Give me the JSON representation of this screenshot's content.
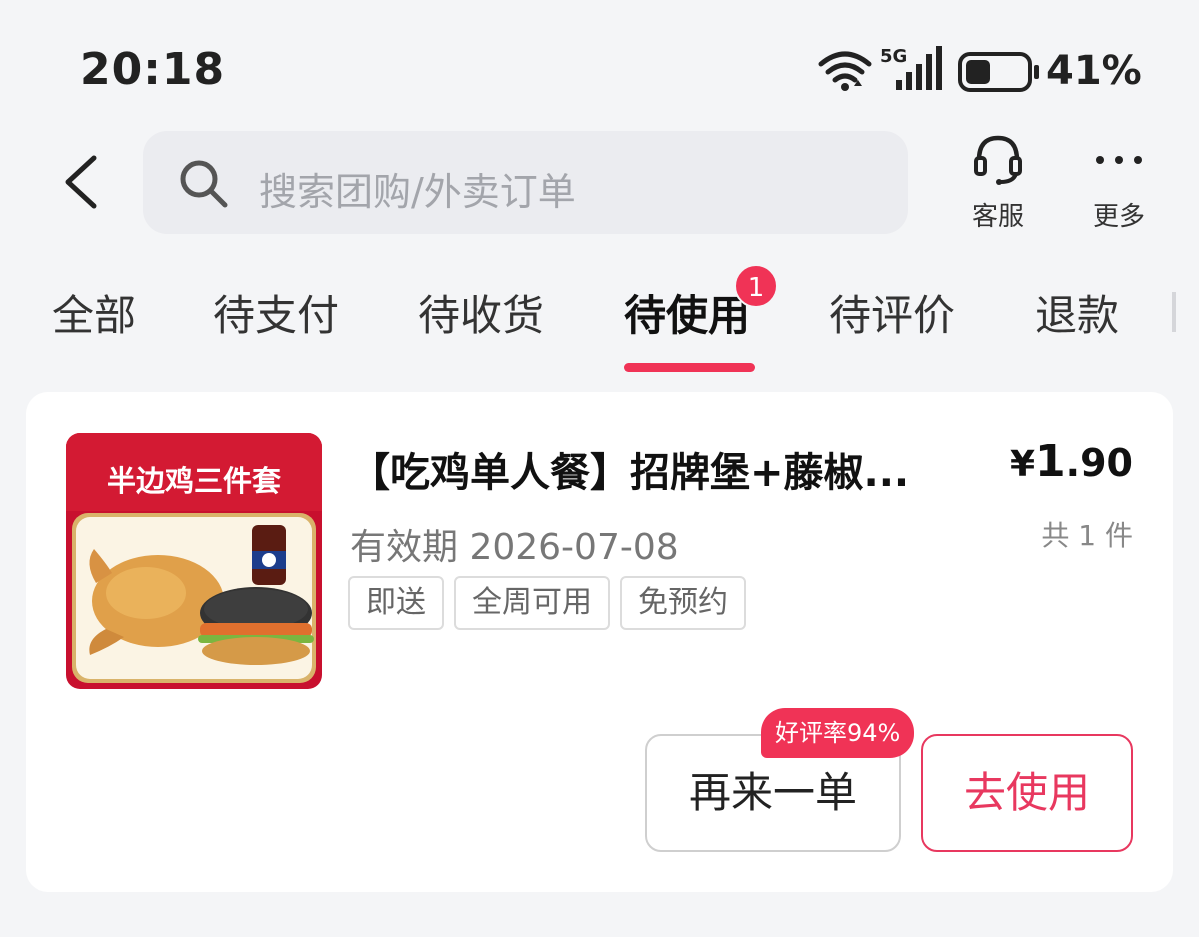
{
  "status_bar": {
    "time": "20:18",
    "network": "5G",
    "battery": "41%",
    "battery_level": 0.41
  },
  "header": {
    "search_placeholder": "搜索团购/外卖订单",
    "service_label": "客服",
    "more_label": "更多"
  },
  "tabs": [
    {
      "label": "全部"
    },
    {
      "label": "待支付"
    },
    {
      "label": "待收货"
    },
    {
      "label": "待使用",
      "badge": "1"
    },
    {
      "label": "待评价"
    },
    {
      "label": "退款"
    }
  ],
  "order": {
    "thumb_text": "半边鸡三件套",
    "title": "【吃鸡单人餐】招牌堡+藤椒...",
    "price_currency": "¥",
    "price_int": "1",
    "price_dec": ".90",
    "count": "共 1 件",
    "validity": "有效期 2026-07-08",
    "tags": [
      "即送",
      "全周可用",
      "免预约"
    ],
    "rating_badge": "好评率94%",
    "reorder_label": "再来一单",
    "use_label": "去使用"
  },
  "colors": {
    "accent": "#f03356",
    "background": "#f4f5f7"
  }
}
